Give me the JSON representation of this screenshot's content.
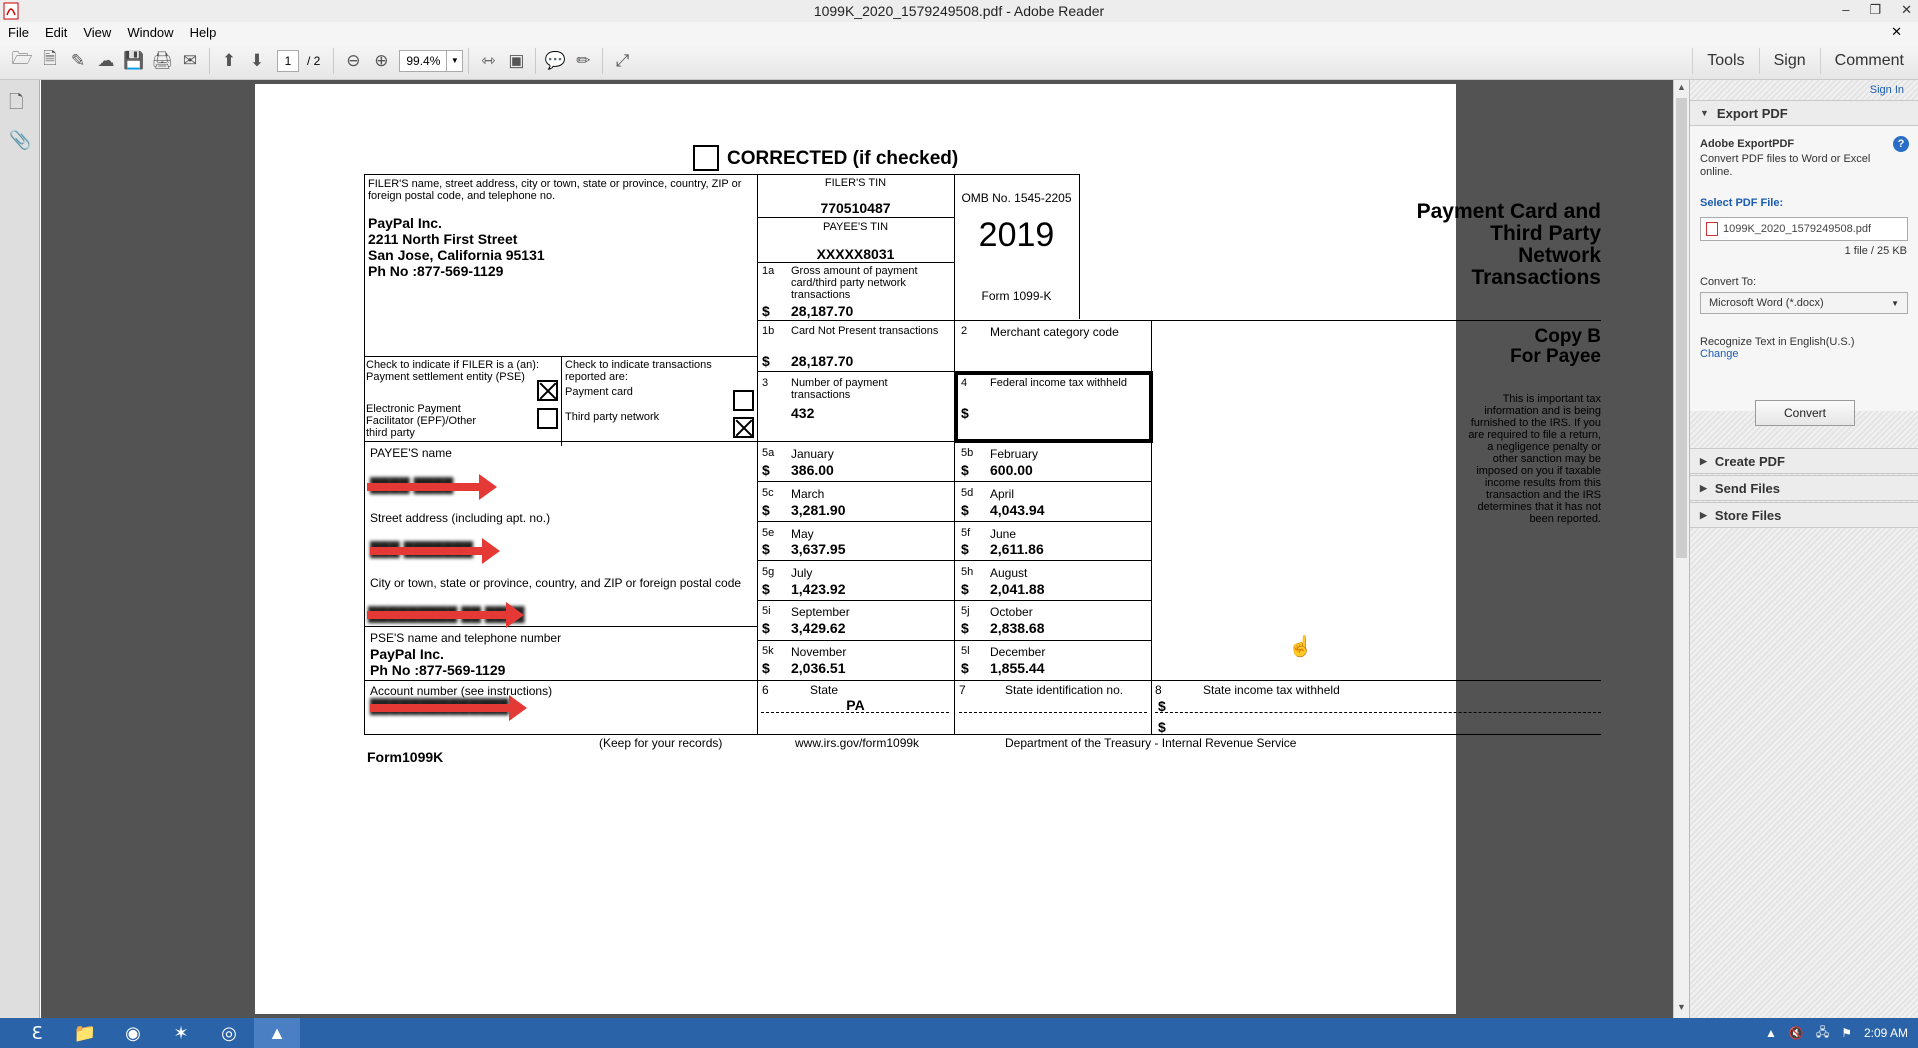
{
  "window": {
    "title": "1099K_2020_1579249508.pdf - Adobe Reader"
  },
  "menu": [
    "File",
    "Edit",
    "View",
    "Window",
    "Help"
  ],
  "toolbar": {
    "page_current": "1",
    "page_total": "/ 2",
    "zoom": "99.4%",
    "right": [
      "Tools",
      "Sign",
      "Comment"
    ]
  },
  "form": {
    "corrected": "CORRECTED (if checked)",
    "filer_label": "FILER'S name, street address, city or town, state or province, country, ZIP or foreign postal code, and telephone no.",
    "filer_name": "PayPal Inc.",
    "filer_street": "2211 North First Street",
    "filer_city": "San Jose, California 95131",
    "filer_phone": "Ph No :877-569-1129",
    "filer_tin_label": "FILER'S TIN",
    "filer_tin": "770510487",
    "payee_tin_label": "PAYEE'S TIN",
    "payee_tin": "XXXXX8031",
    "omb": "OMB No. 1545-2205",
    "year": "2019",
    "form_name": "Form 1099-K",
    "title_lines": [
      "Payment Card and",
      "Third Party",
      "Network",
      "Transactions"
    ],
    "copy_b": "Copy B",
    "for_payee": "For Payee",
    "notice": "This is important tax information and is being furnished to the IRS. If you are required to file a return, a negligence penalty or other sanction may be imposed on you if taxable income results from this transaction and the IRS determines that it has not been reported.",
    "box1a_label": "Gross amount of payment card/third party network transactions",
    "box1a_value": "28,187.70",
    "box1b_label": "Card Not Present transactions",
    "box1b_value": "28,187.70",
    "box2_label": "Merchant category code",
    "box3_label": "Number of payment transactions",
    "box3_value": "432",
    "box4_label": "Federal income tax withheld",
    "check_filer_label": "Check to indicate if FILER is a (an):",
    "pse_label": "Payment settlement entity (PSE)",
    "epf_label": "Electronic Payment Facilitator (EPF)/Other third party",
    "check_trans_label": "Check to indicate transactions reported are:",
    "payment_card_label": "Payment card",
    "third_party_label": "Third party network",
    "payee_name_label": "PAYEE'S name",
    "street_label": "Street address (including apt. no.)",
    "city_label": "City or town, state or province, country, and ZIP or foreign postal code",
    "pse_name_label": "PSE'S name and telephone number",
    "pse_name": "PayPal Inc.",
    "pse_phone": "Ph No :877-569-1129",
    "account_label": "Account number (see instructions)",
    "months": [
      {
        "box": "5a",
        "name": "January",
        "value": "386.00"
      },
      {
        "box": "5b",
        "name": "February",
        "value": "600.00"
      },
      {
        "box": "5c",
        "name": "March",
        "value": "3,281.90"
      },
      {
        "box": "5d",
        "name": "April",
        "value": "4,043.94"
      },
      {
        "box": "5e",
        "name": "May",
        "value": "3,637.95"
      },
      {
        "box": "5f",
        "name": "June",
        "value": "2,611.86"
      },
      {
        "box": "5g",
        "name": "July",
        "value": "1,423.92"
      },
      {
        "box": "5h",
        "name": "August",
        "value": "2,041.88"
      },
      {
        "box": "5i",
        "name": "September",
        "value": "3,429.62"
      },
      {
        "box": "5j",
        "name": "October",
        "value": "2,838.68"
      },
      {
        "box": "5k",
        "name": "November",
        "value": "2,036.51"
      },
      {
        "box": "5l",
        "name": "December",
        "value": "1,855.44"
      }
    ],
    "box6_label": "State",
    "box6_value": "PA",
    "box7_label": "State identification no.",
    "box8_label": "State income tax withheld",
    "footer_form": "Form1099K",
    "footer_keep": "(Keep for your records)",
    "footer_url": "www.irs.gov/form1099k",
    "footer_dept": "Department of the Treasury - Internal Revenue Service",
    "dollar": "$"
  },
  "panel": {
    "signin": "Sign In",
    "export_pdf": "Export PDF",
    "adobe_export": "Adobe ExportPDF",
    "export_desc": "Convert PDF files to Word or Excel online.",
    "select_file_label": "Select PDF File:",
    "file_name": "1099K_2020_1579249508.pdf",
    "file_count": "1 file / 25 KB",
    "convert_to_label": "Convert To:",
    "convert_to_value": "Microsoft Word (*.docx)",
    "recognize": "Recognize Text in English(U.S.)",
    "change": "Change",
    "convert_btn": "Convert",
    "create_pdf": "Create PDF",
    "send_files": "Send Files",
    "store_files": "Store Files"
  },
  "taskbar": {
    "time": "2:09 AM"
  }
}
